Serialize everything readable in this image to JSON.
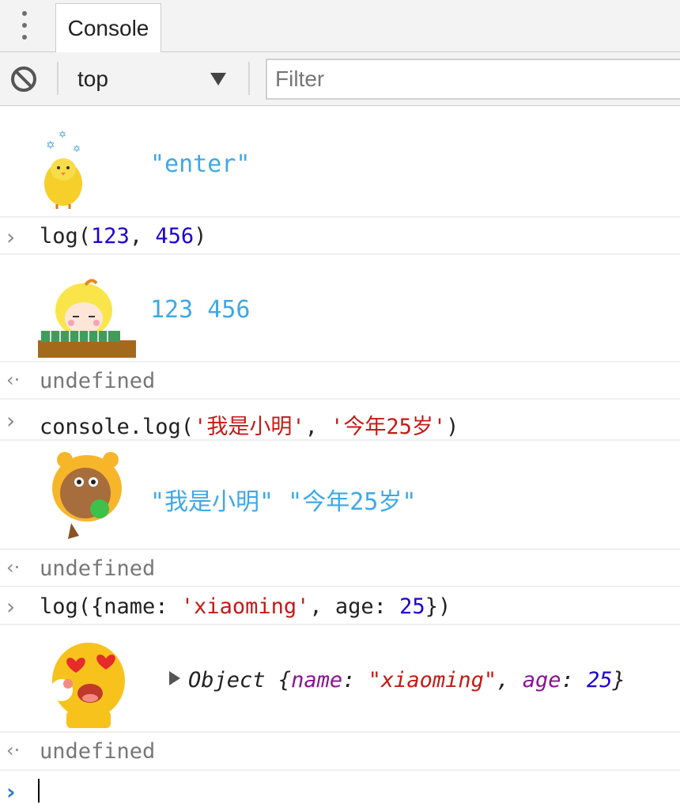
{
  "tabbar": {
    "tab_label": "Console"
  },
  "toolbar": {
    "context": "top",
    "filter_placeholder": "Filter"
  },
  "console": {
    "msg1": "\"enter\"",
    "cmd1": {
      "fn": "log(",
      "a": "123",
      "sep": ", ",
      "b": "456",
      "close": ")"
    },
    "out1": "123 456",
    "ret1": "undefined",
    "cmd2": {
      "fn": "console.log(",
      "a": "'我是小明'",
      "sep": ", ",
      "b": "'今年25岁'",
      "close": ")"
    },
    "out2": "\"我是小明\" \"今年25岁\"",
    "ret2": "undefined",
    "cmd3": {
      "p1": "log({name: ",
      "s": "'xiaoming'",
      "p2": ", age: ",
      "n": "25",
      "p3": "})"
    },
    "out3": {
      "type": "Object",
      "open": " {",
      "k1": "name",
      "colon1": ": ",
      "v1": "\"xiaoming\"",
      "comma": ", ",
      "k2": "age",
      "colon2": ": ",
      "v2": "25",
      "close": "}"
    },
    "ret3": "undefined"
  },
  "icons": {
    "clear": "block-icon",
    "prompt": "chevron-right-icon",
    "result": "left-arrow-icon"
  },
  "colors": {
    "output_blue": "#3ea8e8",
    "number": "#1c00cf",
    "string": "#c41a16",
    "key": "#881391",
    "prompt_active": "#2d7bd6"
  }
}
